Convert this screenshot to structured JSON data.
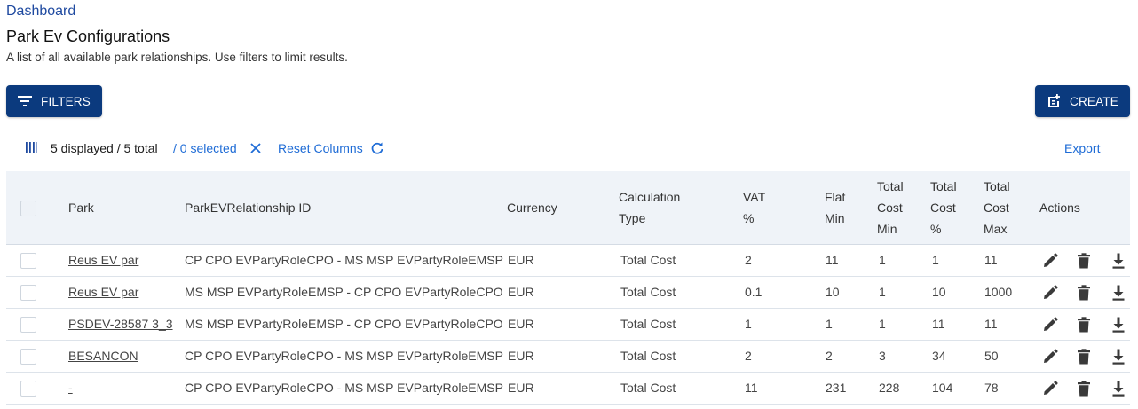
{
  "breadcrumb": "Dashboard",
  "page": {
    "title": "Park Ev Configurations",
    "subtitle": "A list of all available park relationships. Use filters to limit results."
  },
  "buttons": {
    "filters": "FILTERS",
    "create": "CREATE"
  },
  "toolbar": {
    "displayed": "5 displayed / 5 total",
    "selected": "/ 0 selected",
    "reset_columns": "Reset Columns",
    "export": "Export"
  },
  "table": {
    "headers": {
      "park": "Park",
      "relationship_id": "ParkEVRelationship ID",
      "currency": "Currency",
      "calc_type": [
        "Calculation",
        "Type"
      ],
      "vat": [
        "VAT",
        "%"
      ],
      "flat_min": [
        "Flat",
        "Min"
      ],
      "total_cost_min": [
        "Total",
        "Cost",
        "Min"
      ],
      "total_cost_pct": [
        "Total",
        "Cost",
        "%"
      ],
      "total_cost_max": [
        "Total",
        "Cost",
        "Max"
      ],
      "actions": "Actions"
    },
    "rows": [
      {
        "park": "Reus EV par",
        "relationship_id": "CP CPO EVPartyRoleCPO - MS MSP EVPartyRoleEMSP",
        "currency": "EUR",
        "calc_type": "Total Cost",
        "vat": "2",
        "flat_min": "11",
        "total_cost_min": "1",
        "total_cost_pct": "1",
        "total_cost_max": "11"
      },
      {
        "park": "Reus EV par",
        "relationship_id": "MS MSP EVPartyRoleEMSP - CP CPO EVPartyRoleCPO",
        "currency": "EUR",
        "calc_type": "Total Cost",
        "vat": "0.1",
        "flat_min": "10",
        "total_cost_min": "1",
        "total_cost_pct": "10",
        "total_cost_max": "1000"
      },
      {
        "park": "PSDEV-28587 3_3",
        "relationship_id": "MS MSP EVPartyRoleEMSP - CP CPO EVPartyRoleCPO",
        "currency": "EUR",
        "calc_type": "Total Cost",
        "vat": "1",
        "flat_min": "1",
        "total_cost_min": "1",
        "total_cost_pct": "11",
        "total_cost_max": "11"
      },
      {
        "park": "BESANCON",
        "relationship_id": "CP CPO EVPartyRoleCPO - MS MSP EVPartyRoleEMSP",
        "currency": "EUR",
        "calc_type": "Total Cost",
        "vat": "2",
        "flat_min": "2",
        "total_cost_min": "3",
        "total_cost_pct": "34",
        "total_cost_max": "50"
      },
      {
        "park": "-",
        "relationship_id": "CP CPO EVPartyRoleCPO - MS MSP EVPartyRoleEMSP",
        "currency": "EUR",
        "calc_type": "Total Cost",
        "vat": "11",
        "flat_min": "231",
        "total_cost_min": "228",
        "total_cost_pct": "104",
        "total_cost_max": "78"
      }
    ]
  },
  "icons": {
    "filters": "filter-lines-icon",
    "create": "add-document-icon",
    "columns": "columns-icon",
    "clear": "close-icon",
    "reset": "refresh-icon",
    "edit": "pencil-icon",
    "delete": "trash-icon",
    "download": "download-icon"
  },
  "colors": {
    "primary": "#0b3a7e",
    "link": "#1f6cd6",
    "header_bg": "#eff3f8",
    "icon": "#3a3a3a"
  }
}
